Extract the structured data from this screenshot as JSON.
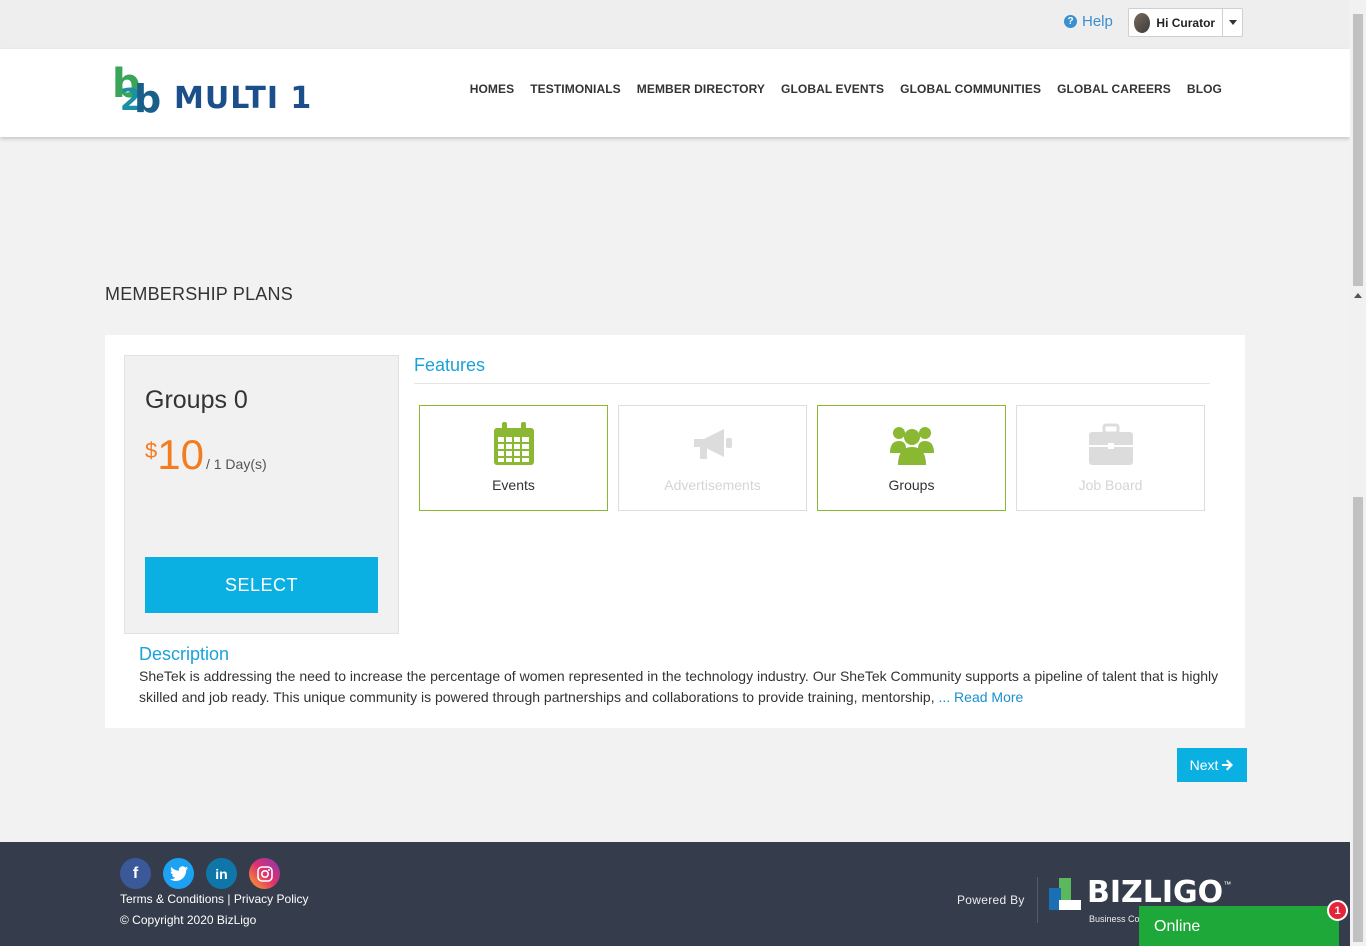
{
  "topbar": {
    "help_label": "Help",
    "user_label": "Hi Curator"
  },
  "header": {
    "logo_text": "MULTI 1",
    "nav": [
      "HOMES",
      "TESTIMONIALS",
      "MEMBER DIRECTORY",
      "GLOBAL EVENTS",
      "GLOBAL COMMUNITIES",
      "GLOBAL CAREERS",
      "BLOG"
    ]
  },
  "main": {
    "section_title": "MEMBERSHIP PLANS",
    "plan": {
      "name": "Groups 0",
      "currency": "$",
      "amount": "10",
      "period": "/ 1 Day(s)",
      "select_label": "SELECT"
    },
    "features_title": "Features",
    "features": [
      {
        "label": "Events",
        "icon": "calendar-icon",
        "enabled": true
      },
      {
        "label": "Advertisements",
        "icon": "megaphone-icon",
        "enabled": false
      },
      {
        "label": "Groups",
        "icon": "users-icon",
        "enabled": true
      },
      {
        "label": "Job Board",
        "icon": "briefcase-icon",
        "enabled": false
      }
    ],
    "description_title": "Description",
    "description_text": "SheTek is addressing the need to increase the percentage of women represented in the technology industry. Our SheTek Community supports a pipeline of talent that is highly skilled and job ready. This unique community is powered through partnerships and collaborations to provide training, mentorship, ",
    "read_more": "... Read More",
    "next_label": "Next"
  },
  "footer": {
    "terms": "Terms & Conditions",
    "separator": " | ",
    "privacy": "Privacy Policy",
    "copyright": "© Copyright 2020 BizLigo",
    "powered_by": "Powered By",
    "brand": "BIZLIGO",
    "brand_tm": "™",
    "brand_sub": "Business Co"
  },
  "chat": {
    "status": "Online",
    "badge_count": "1"
  },
  "colors": {
    "accent": "#0bb0e3",
    "price": "#f47c20",
    "feature_active": "#8ab833",
    "footer_bg": "#353c4b",
    "online": "#1fa83a"
  }
}
